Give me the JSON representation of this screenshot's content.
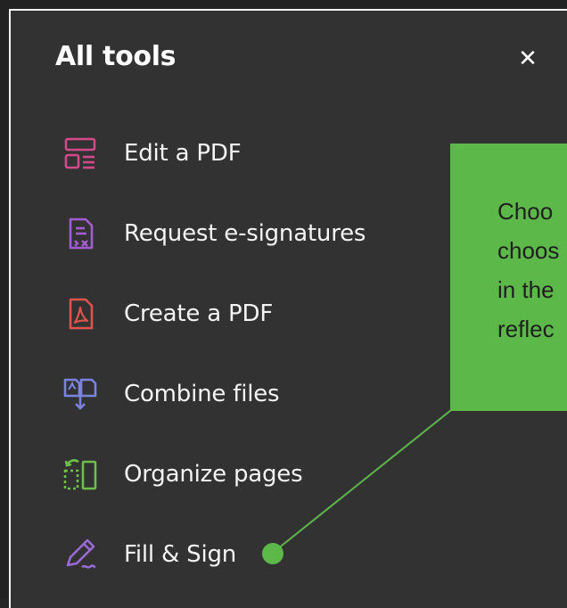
{
  "panel": {
    "title": "All tools",
    "close_glyph": "✕"
  },
  "tools": [
    {
      "label": "Edit a PDF",
      "icon": "edit-pdf-icon",
      "color": "#d24a8a"
    },
    {
      "label": "Request e-signatures",
      "icon": "request-signature-icon",
      "color": "#a45dd0"
    },
    {
      "label": "Create a PDF",
      "icon": "create-pdf-icon",
      "color": "#e0524c"
    },
    {
      "label": "Combine files",
      "icon": "combine-files-icon",
      "color": "#7b83e0"
    },
    {
      "label": "Organize pages",
      "icon": "organize-pages-icon",
      "color": "#6cc04a"
    },
    {
      "label": "Fill & Sign",
      "icon": "fill-sign-icon",
      "color": "#9a6ad6"
    }
  ],
  "callout": {
    "lines": [
      "Choo",
      "choos",
      "in the",
      "reflec"
    ],
    "background": "#5db84a"
  }
}
